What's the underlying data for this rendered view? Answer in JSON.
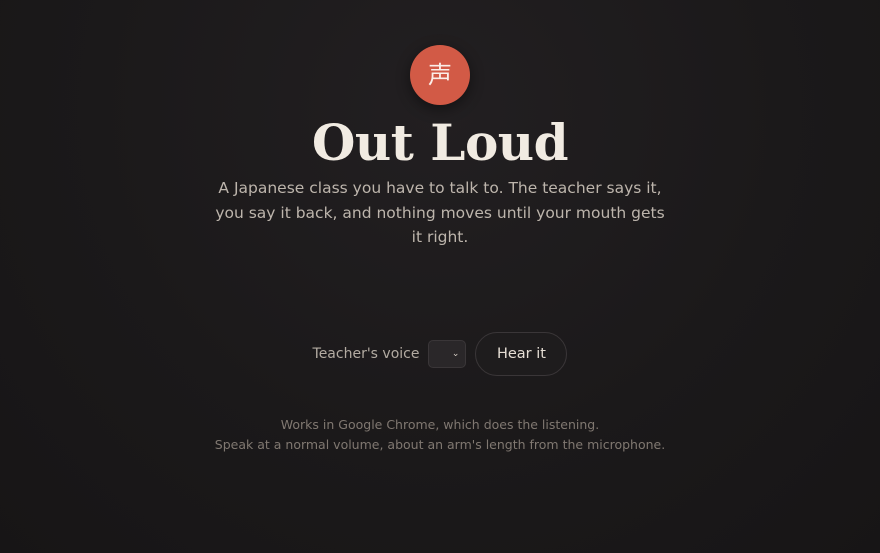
{
  "logo": {
    "glyph": "声"
  },
  "header": {
    "title": "Out Loud",
    "subtitle": "A Japanese class you have to talk to. The teacher says it, you say it back, and nothing moves until your mouth gets it right."
  },
  "controls": {
    "voice_label": "Teacher's voice",
    "voice_select": {
      "chevron": "⌄",
      "selected": ""
    },
    "hear_button_label": "Hear it"
  },
  "footer": {
    "line1": "Works in Google Chrome, which does the listening.",
    "line2": "Speak at a normal volume, about an arm's length from the microphone."
  },
  "colors": {
    "logo_bg": "#d25a46",
    "background": "#1b191a",
    "title": "#f1ebe2"
  }
}
